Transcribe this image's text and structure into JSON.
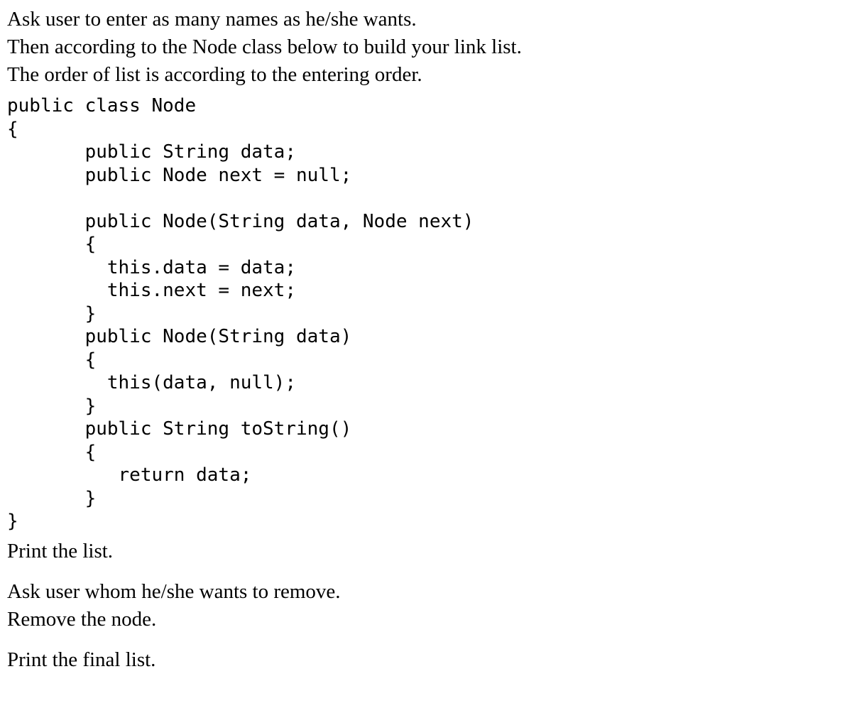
{
  "intro": {
    "line1": "Ask user to enter as many names as he/she wants.",
    "line2": "Then according to the Node class below to build your link list.",
    "line3": "The order of list is according to the entering order."
  },
  "code": "public class Node\n{\n       public String data;\n       public Node next = null;\n\n       public Node(String data, Node next)\n       {\n         this.data = data;\n         this.next = next;\n       }\n       public Node(String data)\n       {\n         this(data, null);\n       }\n       public String toString()\n       {\n          return data;\n       }\n}",
  "outro": {
    "print1": "Print the list.",
    "ask": "Ask user whom he/she wants to remove.",
    "remove": "Remove the node.",
    "print2": "Print the final list."
  }
}
